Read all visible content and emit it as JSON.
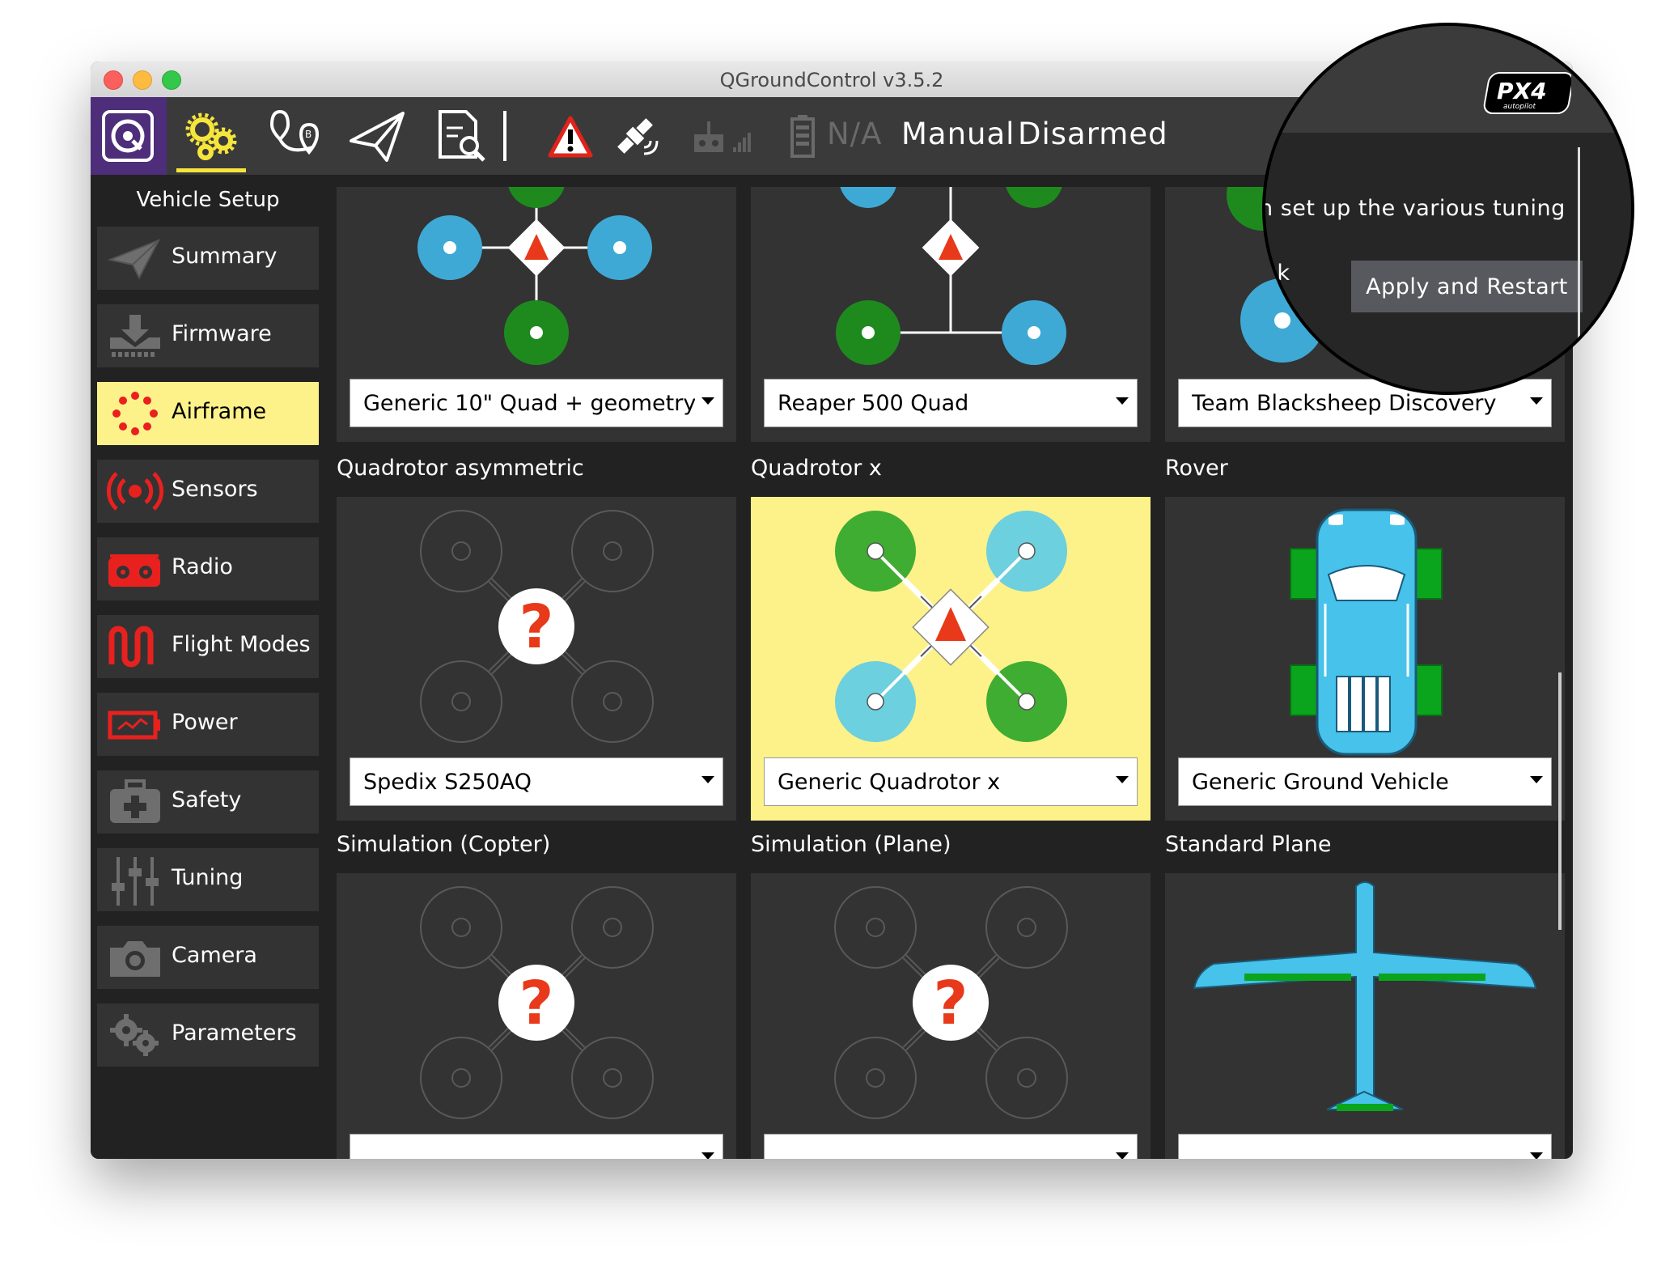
{
  "window": {
    "title": "QGroundControl v3.5.2"
  },
  "toolbar": {
    "icons": [
      "qgc-logo-icon",
      "vehicle-setup-icon",
      "plan-view-icon",
      "fly-view-icon",
      "analyze-icon",
      "warning-icon",
      "gps-icon",
      "rc-rssi-icon",
      "battery-icon"
    ],
    "battery_value": "N/A",
    "flight_mode": "Manual",
    "armed_state": "Disarmed"
  },
  "sidebar": {
    "title": "Vehicle Setup",
    "items": [
      {
        "label": "Summary",
        "icon": "paper-plane-icon"
      },
      {
        "label": "Firmware",
        "icon": "download-icon"
      },
      {
        "label": "Airframe",
        "icon": "airframe-dots-icon",
        "active": true
      },
      {
        "label": "Sensors",
        "icon": "sensor-icon"
      },
      {
        "label": "Radio",
        "icon": "radio-icon"
      },
      {
        "label": "Flight Modes",
        "icon": "flight-modes-icon"
      },
      {
        "label": "Power",
        "icon": "battery-icon"
      },
      {
        "label": "Safety",
        "icon": "first-aid-icon"
      },
      {
        "label": "Tuning",
        "icon": "sliders-icon"
      },
      {
        "label": "Camera",
        "icon": "camera-icon"
      },
      {
        "label": "Parameters",
        "icon": "gears-icon"
      }
    ]
  },
  "airframe": {
    "rows": [
      {
        "cards": [
          {
            "selection": "Generic 10\" Quad + geometry"
          },
          {
            "selection": "Reaper 500 Quad"
          },
          {
            "selection": "Team Blacksheep Discovery"
          }
        ]
      },
      {
        "cards": [
          {
            "group": "Quadrotor asymmetric",
            "selection": "Spedix S250AQ"
          },
          {
            "group": "Quadrotor x",
            "selection": "Generic Quadrotor x",
            "active": true
          },
          {
            "group": "Rover",
            "selection": "Generic Ground Vehicle"
          }
        ]
      },
      {
        "cards": [
          {
            "group": "Simulation (Copter)",
            "selection": ""
          },
          {
            "group": "Simulation (Plane)",
            "selection": ""
          },
          {
            "group": "Standard Plane",
            "selection": ""
          }
        ]
      }
    ]
  },
  "magnifier": {
    "brand_logo": "PX4 autopilot",
    "text_fragment_1": "n set up the various tuning",
    "text_fragment_2": "ick",
    "apply_button_label": "Apply and Restart"
  },
  "colors": {
    "accent_yellow": "#fdf18a",
    "sidebar_icon_red": "#e8211f",
    "motor_green": "#1e8a1e",
    "motor_blue": "#3fa9d6",
    "vehicle_blue": "#47c2ea"
  }
}
